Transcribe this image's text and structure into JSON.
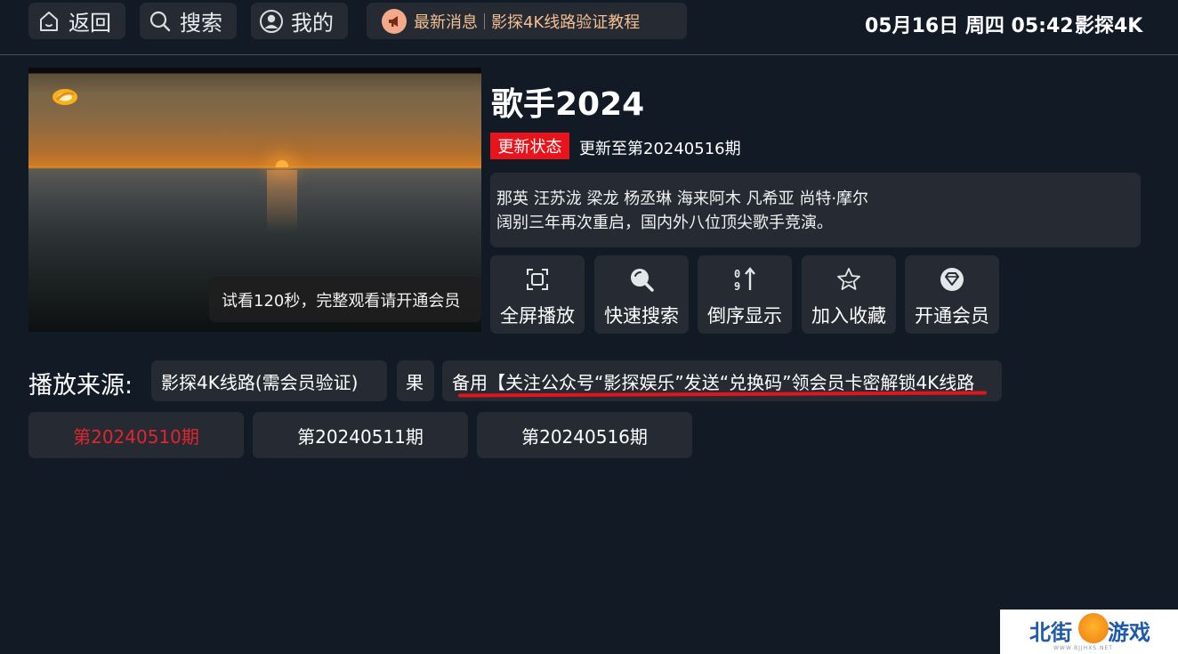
{
  "topbar": {
    "back_label": "返回",
    "search_label": "搜索",
    "profile_label": "我的",
    "news_title": "最新消息",
    "news_text": "影探4K线路验证教程",
    "datetime": "05月16日 周四 05:42",
    "brand": "影探4K"
  },
  "video": {
    "trial_tip": "试看120秒，完整观看请开通会员"
  },
  "show": {
    "title": "歌手2024",
    "status_badge": "更新状态",
    "status_text": "更新至第20240516期",
    "cast": "那英 汪苏泷 梁龙 杨丞琳 海来阿木 凡希亚 尚特·摩尔",
    "description": "阔别三年再次重启，国内外八位顶尖歌手竞演。"
  },
  "actions": [
    {
      "label": "全屏播放",
      "icon": "fullscreen-icon"
    },
    {
      "label": "快速搜索",
      "icon": "search-icon"
    },
    {
      "label": "倒序显示",
      "icon": "sort-icon"
    },
    {
      "label": "加入收藏",
      "icon": "star-icon"
    },
    {
      "label": "开通会员",
      "icon": "vip-icon"
    }
  ],
  "sources": {
    "label": "播放来源:",
    "items": [
      "影探4K线路(需会员验证)",
      "果",
      "备用【关注公众号“影探娱乐”发送“兑换码”领会员卡密解锁4K线路"
    ]
  },
  "episodes": [
    {
      "label": "第20240510期",
      "active": true
    },
    {
      "label": "第20240511期",
      "active": false
    },
    {
      "label": "第20240516期",
      "active": false
    }
  ],
  "watermark": {
    "part_a": "北街",
    "part_b": "游戏",
    "url": "WWW.BJJHXS.NET"
  },
  "colors": {
    "background": "#121a26",
    "button": "#262b33",
    "accent_red": "#e8141c",
    "news_text": "#f3bf93"
  }
}
